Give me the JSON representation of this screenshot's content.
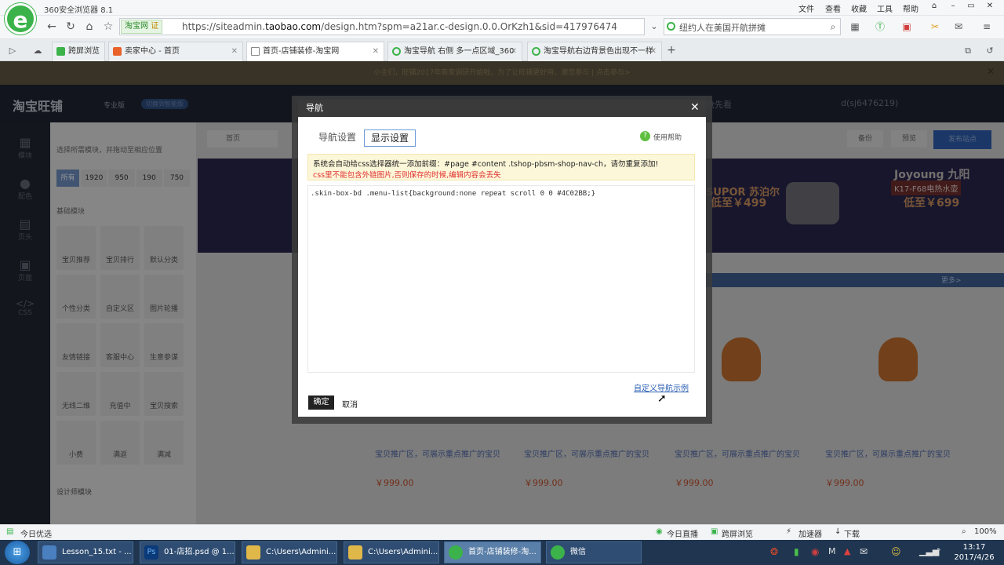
{
  "browser": {
    "app_title": "360安全浏览器 8.1",
    "logo_letter": "e",
    "menu": [
      "文件",
      "查看",
      "收藏",
      "工具",
      "帮助"
    ],
    "site_badge": "淘宝网",
    "cert_badge": "证",
    "url_prefix": "https://siteadmin.",
    "url_domain": "taobao.com",
    "url_path": "/design.htm?spm=a21ar.c-design.0.0.OrKzh1&sid=417976474",
    "search_text": "纽约人在美国开航拼摊",
    "tabs": [
      {
        "label": "跨屏浏览",
        "color": "#3bb34a"
      },
      {
        "label": "卖家中心 - 首页",
        "color": "#e8622a"
      },
      {
        "label": "首页-店铺装修-淘宝网",
        "color": "#888888"
      },
      {
        "label": "淘宝导航 右侧 多一点区域_360",
        "color": "#3bb34a"
      },
      {
        "label": "淘宝导航右边背景色出现不一样",
        "color": "#3bb34a"
      }
    ]
  },
  "page": {
    "notice": "小主们，旺铺2017年商家调研开始啦，为了让旺铺更好用，邀您参与 | 点击参与>",
    "header_logo": "淘宝旺铺",
    "header_edition": "专业版",
    "header_switch": "切换到智能版",
    "header_user": "d(sj6476219)",
    "header_firstlook": "抢先看",
    "left_nav": [
      "模块",
      "配色",
      "页头",
      "页面",
      "CSS"
    ],
    "panel_hint": "选择所需模块，并拖动至相应位置",
    "width_filters": [
      "所有",
      "1920",
      "950",
      "190",
      "750"
    ],
    "basic_section": "基础模块",
    "modules": [
      "宝贝推荐",
      "宝贝排行",
      "默认分类",
      "个性分类",
      "自定义区",
      "图片轮播",
      "友情链接",
      "客服中心",
      "生意参谋",
      "无线二维",
      "充值中",
      "宝贝搜索",
      "小费",
      "满返",
      "满减"
    ],
    "designer_section": "设计师模块",
    "breadcrumb": "首页",
    "top_buttons": [
      "备份",
      "预览",
      "发布站点"
    ],
    "banner_left": "SUPOR 苏泊尔",
    "banner_left_sub": "低至￥499",
    "banner_right": "Joyoung 九阳",
    "banner_right_model": "K17-F68电热水壶",
    "banner_right_price": "低至￥699",
    "more_label": "更多>",
    "product_desc": "宝贝推广区，可展示重点推广的宝贝",
    "product_price": "￥999.00",
    "product_count": 4
  },
  "modal": {
    "title": "导航",
    "tabs": [
      "导航设置",
      "显示设置"
    ],
    "active_tab": 1,
    "help": "使用帮助",
    "tip_line1": "系统会自动给css选择器统一添加前缀：#page #content .tshop-pbsm-shop-nav-ch，请勿重复添加!",
    "tip_line2": "css里不能包含外链图片,否则保存的时候,编辑内容会丢失",
    "css_value": ".skin-box-bd .menu-list{background:none repeat scroll 0 0 #4C02BB;}",
    "example_link": "自定义导航示例",
    "ok": "确定",
    "cancel": "取消"
  },
  "status": {
    "left": "今日优选",
    "items": [
      "今日直播",
      "跨屏浏览",
      "加速器",
      "下载"
    ],
    "zoom": "100%"
  },
  "taskbar": {
    "items": [
      {
        "label": "Lesson_15.txt - ...",
        "color": "#4a7fc0"
      },
      {
        "label": "01-店招.psd @ 1...",
        "color": "#0b3a7a"
      },
      {
        "label": "C:\\Users\\Admini...",
        "color": "#e0b84a"
      },
      {
        "label": "C:\\Users\\Admini...",
        "color": "#e0b84a"
      },
      {
        "label": "首页-店铺装修-淘...",
        "color": "#3bb34a"
      },
      {
        "label": "微信",
        "color": "#3bb34a"
      }
    ],
    "time": "13:17",
    "date": "2017/4/26"
  }
}
